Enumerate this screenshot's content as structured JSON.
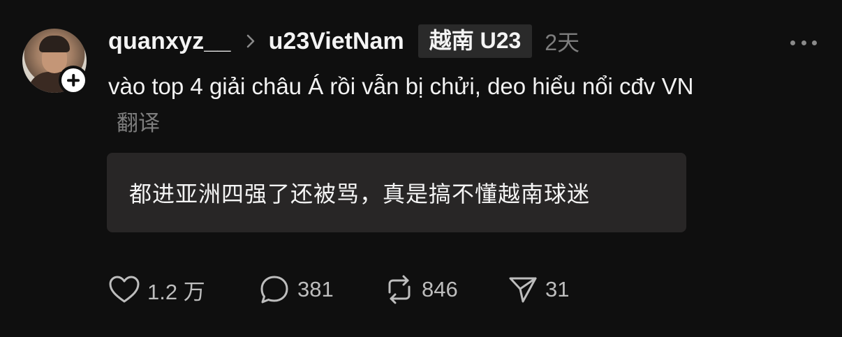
{
  "post": {
    "username": "quanxyz__",
    "community": "u23VietNam",
    "community_tag": "越南 U23",
    "time": "2天",
    "text": "vào top 4 giải châu Á rồi vẫn bị chửi, deo hiểu nổi cđv VN",
    "translate_label": "翻译",
    "translation": "都进亚洲四强了还被骂，真是搞不懂越南球迷"
  },
  "actions": {
    "likes": "1.2 万",
    "comments": "381",
    "reposts": "846",
    "shares": "31"
  },
  "icons": {
    "like": "heart-icon",
    "comment": "comment-bubble-icon",
    "repost": "repost-icon",
    "share": "send-icon",
    "more": "more-dots-icon",
    "follow": "plus-icon",
    "chevron": "chevron-right-icon"
  },
  "colors": {
    "background": "#0f0f0f",
    "primary_text": "#f2f2f2",
    "secondary_text": "#7d7d7d",
    "translation_bg": "#282626",
    "tag_bg": "#2a2a2a"
  }
}
